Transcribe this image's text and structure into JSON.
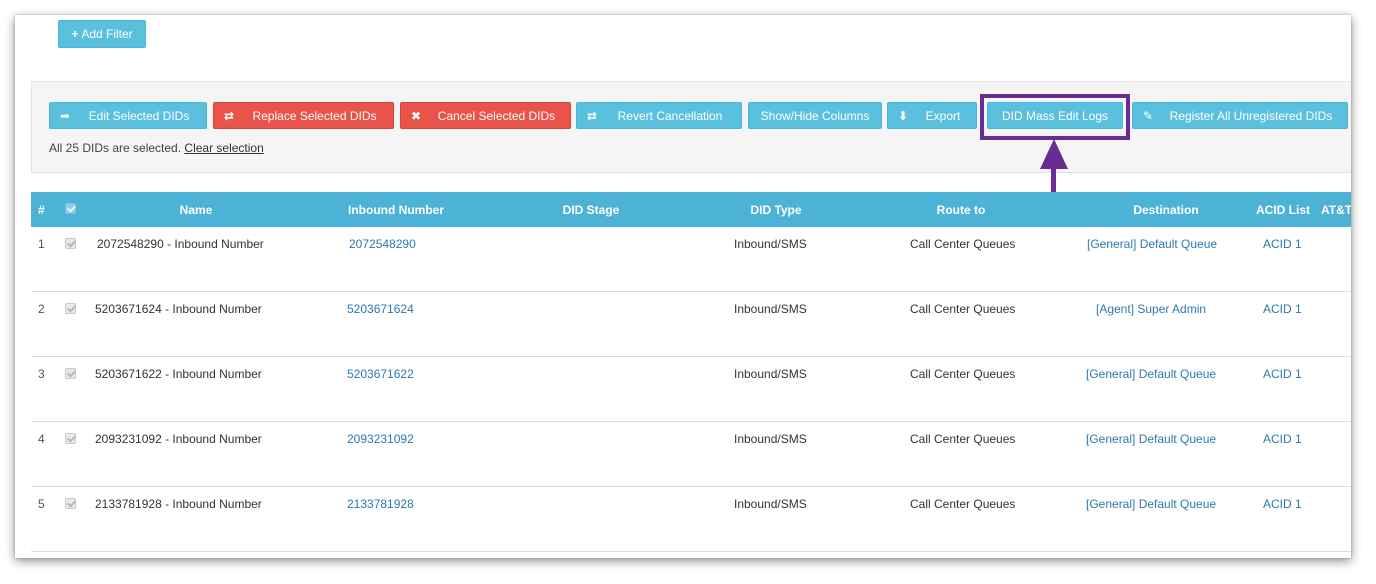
{
  "filters": {
    "add_filter_label": "Add Filter"
  },
  "toolbar": {
    "buttons": [
      {
        "label": "Edit Selected DIDs",
        "icon": "share-icon"
      },
      {
        "label": "Replace Selected DIDs",
        "icon": "retweet-icon"
      },
      {
        "label": "Cancel Selected DIDs",
        "icon": "close-icon"
      },
      {
        "label": "Revert Cancellation",
        "icon": "retweet-icon"
      },
      {
        "label": "Show/Hide Columns"
      },
      {
        "label": "Export",
        "icon": "download-icon"
      },
      {
        "label": "DID Mass Edit Logs"
      },
      {
        "label": "Register All Unregistered DIDs",
        "icon": "edit-icon"
      }
    ],
    "selection_text": "All 25 DIDs are selected.",
    "clear_selection": "Clear selection"
  },
  "table": {
    "columns": [
      "#",
      "Name",
      "Inbound Number",
      "DID Stage",
      "DID Type",
      "Route to",
      "Destination",
      "ACID List",
      "AT&T"
    ],
    "rows": [
      {
        "index": "1",
        "name": "2072548290 - Inbound Number",
        "inbound": "2072548290",
        "stage": "",
        "type": "Inbound/SMS",
        "route": "Call Center Queues",
        "destination": "[General] Default Queue",
        "acid": "ACID 1"
      },
      {
        "index": "2",
        "name": "5203671624 - Inbound Number",
        "inbound": "5203671624",
        "stage": "",
        "type": "Inbound/SMS",
        "route": "Call Center Queues",
        "destination": "[Agent] Super Admin",
        "acid": "ACID 1"
      },
      {
        "index": "3",
        "name": "5203671622 - Inbound Number",
        "inbound": "5203671622",
        "stage": "",
        "type": "Inbound/SMS",
        "route": "Call Center Queues",
        "destination": "[General] Default Queue",
        "acid": "ACID 1"
      },
      {
        "index": "4",
        "name": "2093231092 - Inbound Number",
        "inbound": "2093231092",
        "stage": "",
        "type": "Inbound/SMS",
        "route": "Call Center Queues",
        "destination": "[General] Default Queue",
        "acid": "ACID 1"
      },
      {
        "index": "5",
        "name": "2133781928 - Inbound Number",
        "inbound": "2133781928",
        "stage": "",
        "type": "Inbound/SMS",
        "route": "Call Center Queues",
        "destination": "[General] Default Queue",
        "acid": "ACID 1"
      }
    ]
  },
  "colors": {
    "info": "#5bc0de",
    "danger": "#e8534a",
    "header": "#4cb2d6",
    "highlight": "#6a2c91",
    "link": "#2a7ab0"
  }
}
